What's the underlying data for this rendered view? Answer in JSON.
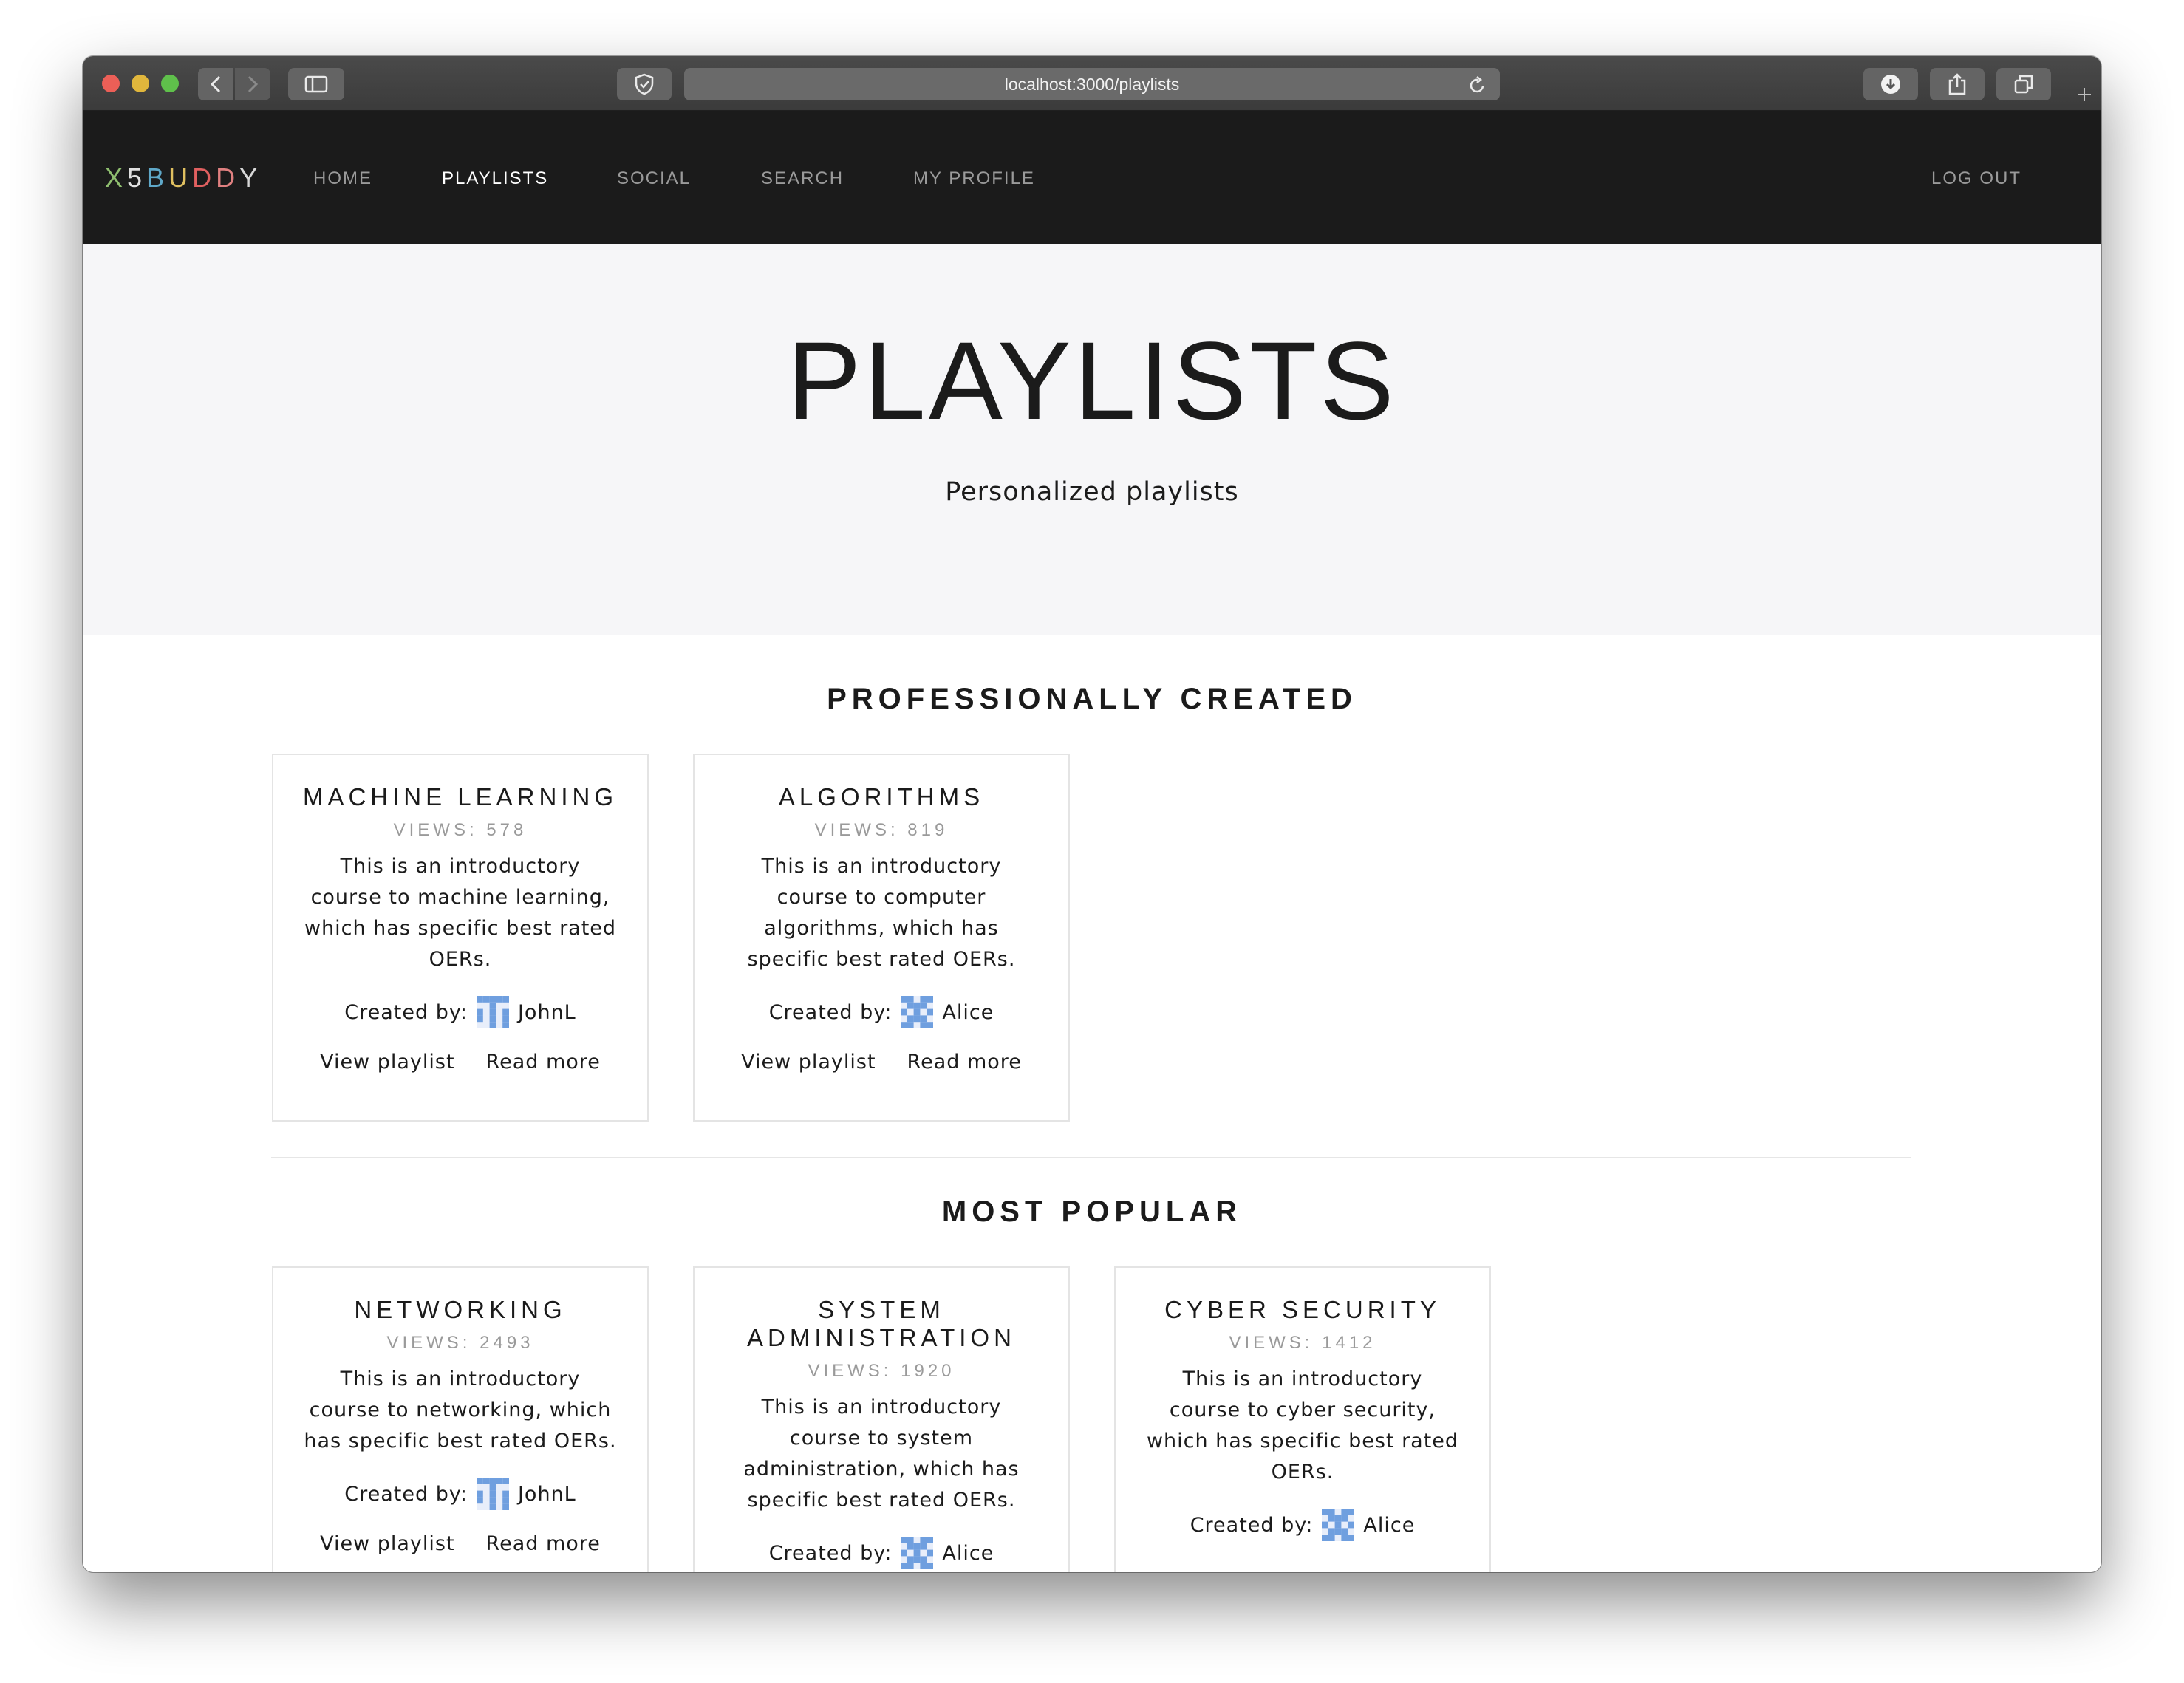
{
  "browser": {
    "url": "localhost:3000/playlists"
  },
  "nav": {
    "brand_letters": [
      {
        "ch": "X",
        "color": "#8fbf6f"
      },
      {
        "ch": "5",
        "color": "#e0e0e0"
      },
      {
        "ch": "B",
        "color": "#5fa8c8"
      },
      {
        "ch": "U",
        "color": "#e0c060"
      },
      {
        "ch": "D",
        "color": "#e06060"
      },
      {
        "ch": "D",
        "color": "#e08080"
      },
      {
        "ch": "Y",
        "color": "#d8d8d8"
      }
    ],
    "items": [
      "HOME",
      "PLAYLISTS",
      "SOCIAL",
      "SEARCH",
      "MY PROFILE"
    ],
    "active": "PLAYLISTS",
    "logout": "LOG OUT"
  },
  "hero": {
    "title": "PLAYLISTS",
    "subtitle": "Personalized playlists"
  },
  "sections": [
    {
      "title": "PROFESSIONALLY CREATED",
      "cards": [
        {
          "title": "MACHINE LEARNING",
          "views": "VIEWS: 578",
          "description": "This is an introductory course to machine learning, which has specific best rated OERs.",
          "created_by_label": "Created by:",
          "creator": "JohnL",
          "avatar": "avatar-johnl-icon",
          "view_label": "View playlist",
          "more_label": "Read more"
        },
        {
          "title": "ALGORITHMS",
          "views": "VIEWS: 819",
          "description": "This is an introductory course to computer algorithms, which has specific best rated OERs.",
          "created_by_label": "Created by:",
          "creator": "Alice",
          "avatar": "avatar-alice-icon",
          "view_label": "View playlist",
          "more_label": "Read more"
        }
      ]
    },
    {
      "title": "MOST POPULAR",
      "cards": [
        {
          "title": "NETWORKING",
          "views": "VIEWS: 2493",
          "description": "This is an introductory course to networking, which has specific best rated OERs.",
          "created_by_label": "Created by:",
          "creator": "JohnL",
          "avatar": "avatar-johnl-icon",
          "view_label": "View playlist",
          "more_label": "Read more"
        },
        {
          "title": "SYSTEM ADMINISTRATION",
          "views": "VIEWS: 1920",
          "description": "This is an introductory course to system administration, which has specific best rated OERs.",
          "created_by_label": "Created by:",
          "creator": "Alice",
          "avatar": "avatar-alice-icon",
          "view_label": "",
          "more_label": ""
        },
        {
          "title": "CYBER SECURITY",
          "views": "VIEWS: 1412",
          "description": "This is an introductory course to cyber security, which has specific best rated OERs.",
          "created_by_label": "Created by:",
          "creator": "Alice",
          "avatar": "avatar-alice-icon",
          "view_label": "",
          "more_label": ""
        }
      ]
    }
  ],
  "colors": {
    "nav_bg": "#1b1b1b",
    "hero_bg": "#f6f6f8",
    "avatar_blue": "#6f9fdf"
  }
}
